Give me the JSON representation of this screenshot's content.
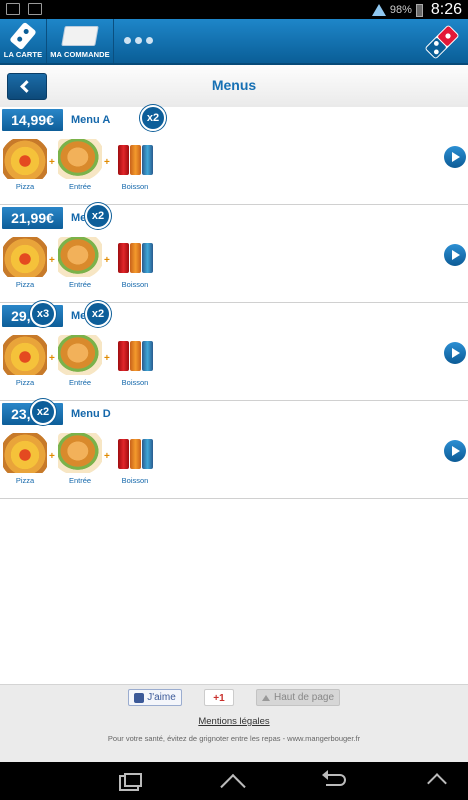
{
  "status_bar": {
    "battery": "98%",
    "time": "8:26"
  },
  "app_header": {
    "nav_items": [
      {
        "label": "LA CARTE",
        "icon": "domino-icon"
      },
      {
        "label": "MA COMMANDE",
        "icon": "pizza-box-icon"
      }
    ],
    "more_icon": "more-dots-icon",
    "logo": "dominos-logo",
    "colors": {
      "header_blue": "#0a5e97",
      "logo_red": "#e31837"
    }
  },
  "title_bar": {
    "title": "Menus",
    "back_icon": "back-arrow-icon"
  },
  "menus": [
    {
      "price": "14,99€",
      "name": "Menu A",
      "items": [
        {
          "label": "Pizza",
          "qty": ""
        },
        {
          "label": "Entrée",
          "qty": ""
        },
        {
          "label": "Boisson",
          "qty": "x2"
        }
      ]
    },
    {
      "price": "21,99€",
      "name": "Menu B",
      "items": [
        {
          "label": "Pizza",
          "qty": ""
        },
        {
          "label": "Entrée",
          "qty": "x2"
        },
        {
          "label": "Boisson",
          "qty": ""
        }
      ]
    },
    {
      "price": "29,99€",
      "name": "Menu C",
      "items": [
        {
          "label": "Pizza",
          "qty": "x3"
        },
        {
          "label": "Entrée",
          "qty": "x2"
        },
        {
          "label": "Boisson",
          "qty": ""
        }
      ]
    },
    {
      "price": "23,99€",
      "name": "Menu D",
      "items": [
        {
          "label": "Pizza",
          "qty": "x2"
        },
        {
          "label": "Entrée",
          "qty": ""
        },
        {
          "label": "Boisson",
          "qty": ""
        }
      ]
    }
  ],
  "footer": {
    "like_label": "J'aime",
    "gplus_label": "+1",
    "top_label": "Haut de page",
    "mentions": "Mentions légales",
    "health_notice": "Pour votre santé, évitez de grignoter entre les repas - www.mangerbouger.fr"
  }
}
